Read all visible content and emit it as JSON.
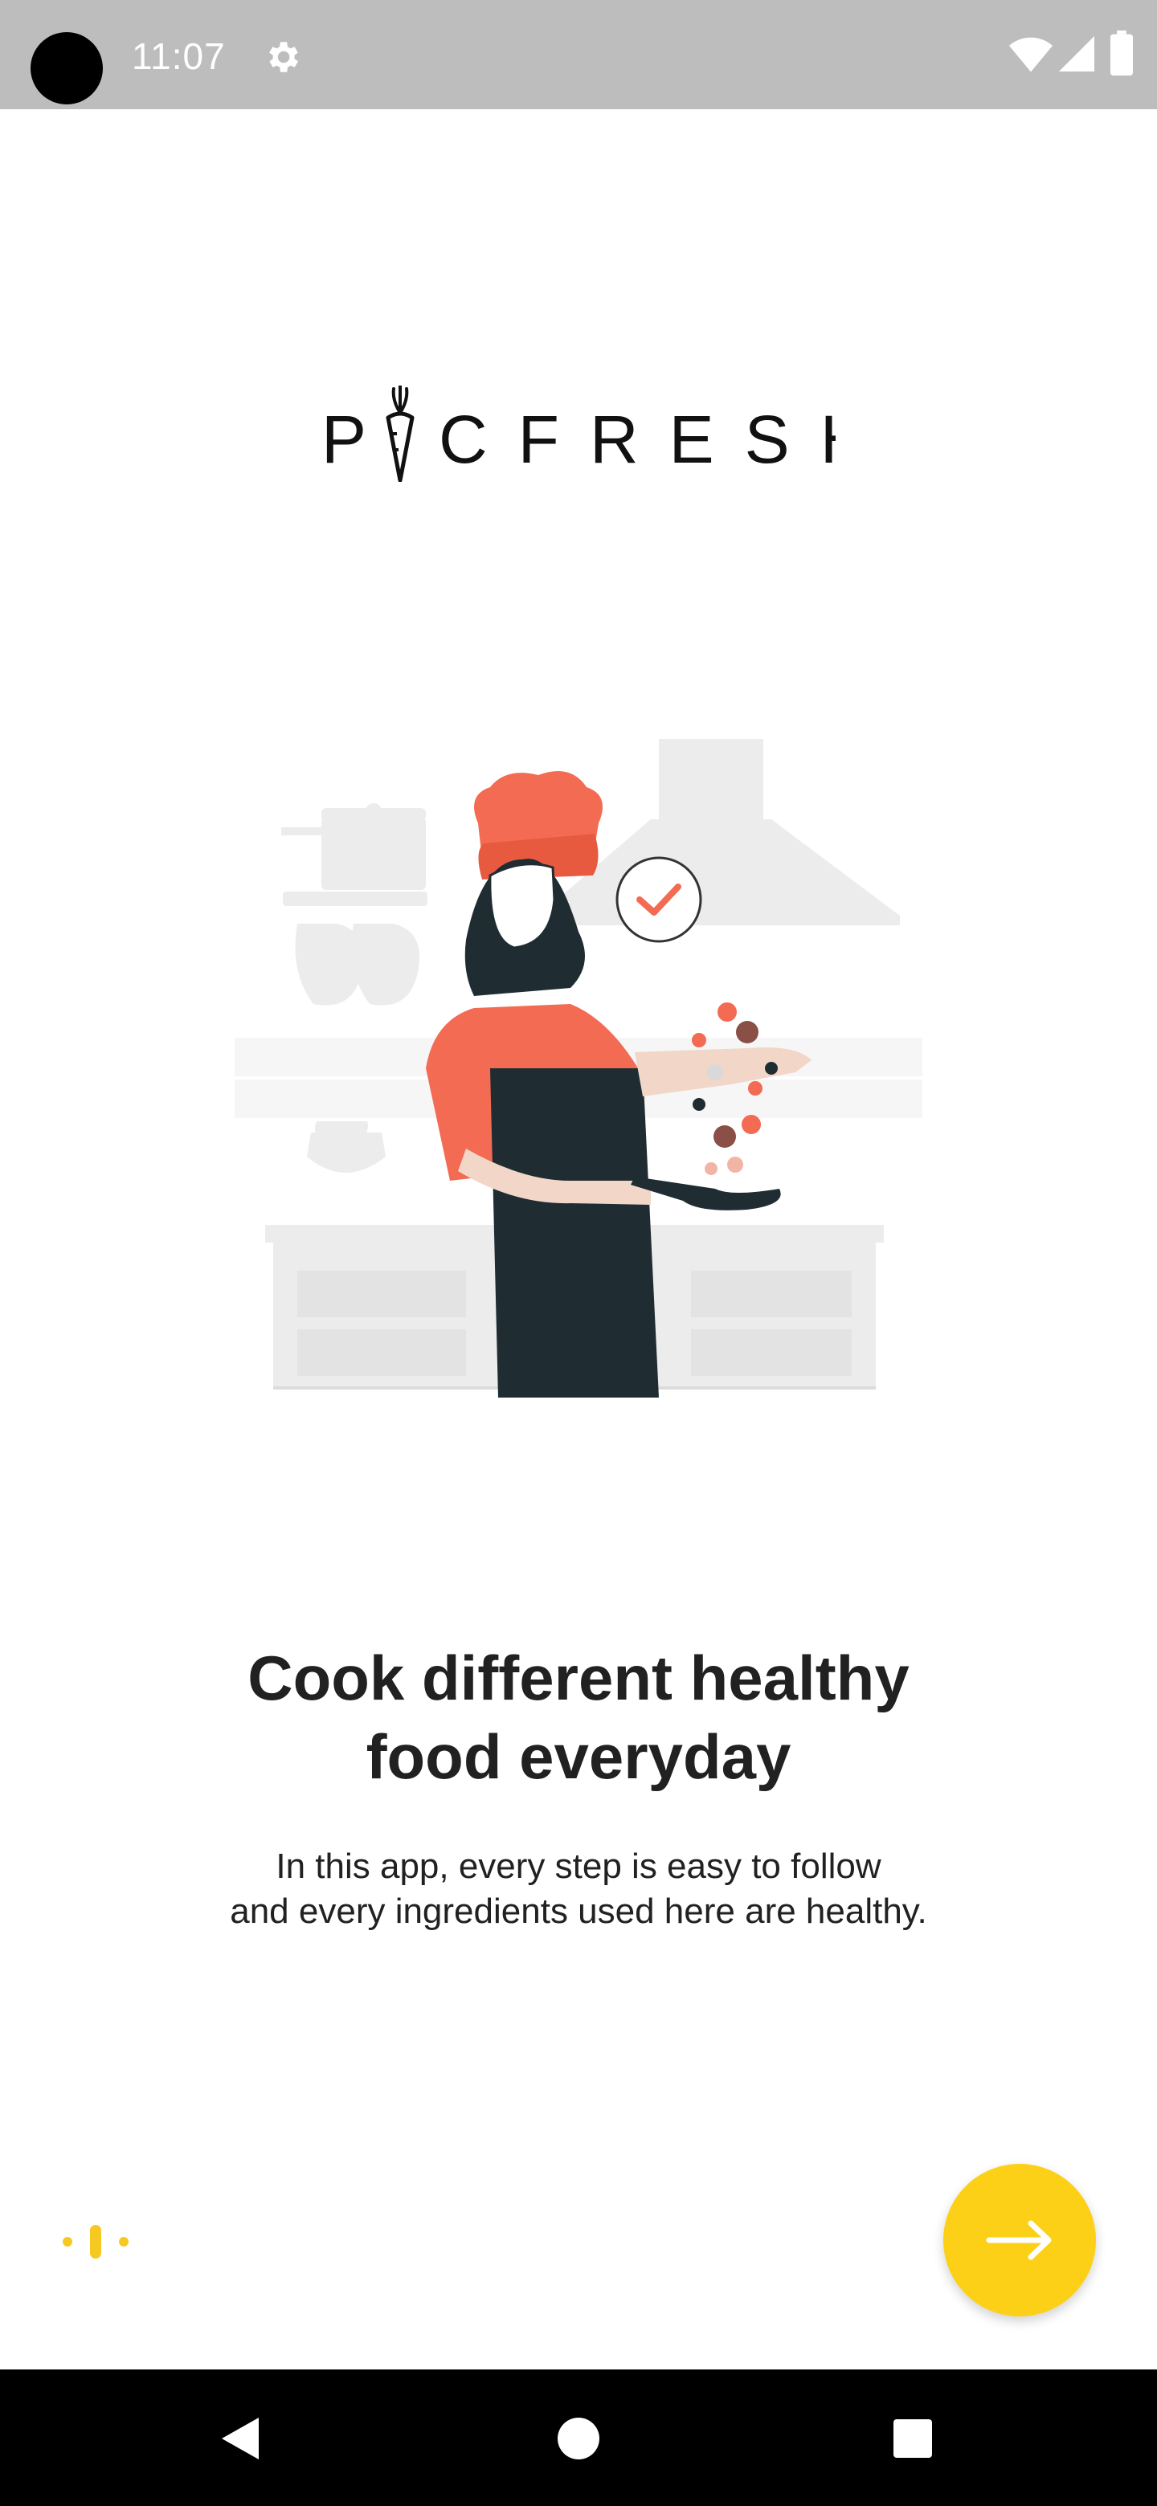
{
  "status_bar": {
    "time": "11:07",
    "icons": [
      "camera-dot",
      "gear-icon",
      "wifi-icon",
      "signal-icon",
      "battery-icon"
    ]
  },
  "logo": {
    "brand_text": "PICFRESH",
    "icon": "carrot-icon"
  },
  "illustration": {
    "subject": "chef-cooking-illustration",
    "accent_color": "#f26b52"
  },
  "onboarding": {
    "title_line1": "Cook different healthy",
    "title_line2": "food everyday",
    "body_line1": "In this app, every step is easy to follow",
    "body_line2": "and every ingredients used here are healthy."
  },
  "pager": {
    "total_pages": 3,
    "active_page": 2,
    "color": "#f6c922"
  },
  "next_button": {
    "icon": "arrow-right-icon",
    "color": "#fdd018"
  },
  "nav_bar": {
    "icons": [
      "back-icon",
      "home-icon",
      "recents-icon"
    ]
  }
}
